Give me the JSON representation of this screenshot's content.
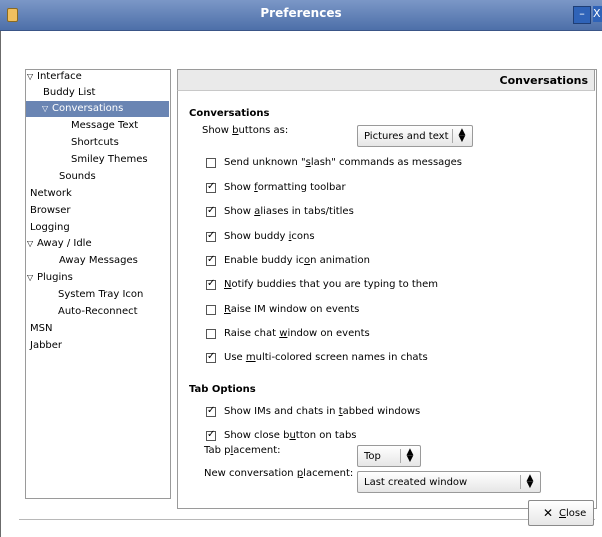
{
  "window": {
    "title": "Preferences"
  },
  "tree": {
    "items": [
      {
        "label": "Interface",
        "expanded": true
      },
      {
        "label": "Buddy List"
      },
      {
        "label": "Conversations",
        "expanded": true,
        "selected": true
      },
      {
        "label": "Message Text"
      },
      {
        "label": "Shortcuts"
      },
      {
        "label": "Smiley Themes"
      },
      {
        "label": "Sounds"
      },
      {
        "label": "Network"
      },
      {
        "label": "Browser"
      },
      {
        "label": "Logging"
      },
      {
        "label": "Away / Idle",
        "expanded": true
      },
      {
        "label": "Away Messages"
      },
      {
        "label": "Plugins",
        "expanded": true
      },
      {
        "label": "System Tray Icon"
      },
      {
        "label": "Auto-Reconnect"
      },
      {
        "label": "MSN"
      },
      {
        "label": "Jabber"
      }
    ]
  },
  "panel": {
    "title": "Conversations",
    "conversations_section": "Conversations",
    "show_buttons_label": "Show buttons as:",
    "show_buttons_value": "Pictures and text",
    "options": [
      {
        "label": "Send unknown \"slash\" commands as messages",
        "checked": false
      },
      {
        "label": "Show formatting toolbar",
        "checked": true
      },
      {
        "label": "Show aliases in tabs/titles",
        "checked": true
      },
      {
        "label": "Show buddy icons",
        "checked": true
      },
      {
        "label": "Enable buddy icon animation",
        "checked": true
      },
      {
        "label": "Notify buddies that you are typing to them",
        "checked": true
      },
      {
        "label": "Raise IM window on events",
        "checked": false
      },
      {
        "label": "Raise chat window on events",
        "checked": false
      },
      {
        "label": "Use multi-colored screen names in chats",
        "checked": true
      }
    ],
    "tab_section": "Tab Options",
    "tab_options": [
      {
        "label": "Show IMs and chats in tabbed windows",
        "checked": true
      },
      {
        "label": "Show close button on tabs",
        "checked": true
      }
    ],
    "tab_placement_label": "Tab placement:",
    "tab_placement_value": "Top",
    "new_conv_label": "New conversation placement:",
    "new_conv_value": "Last created window"
  },
  "footer": {
    "close_label": "Close"
  }
}
